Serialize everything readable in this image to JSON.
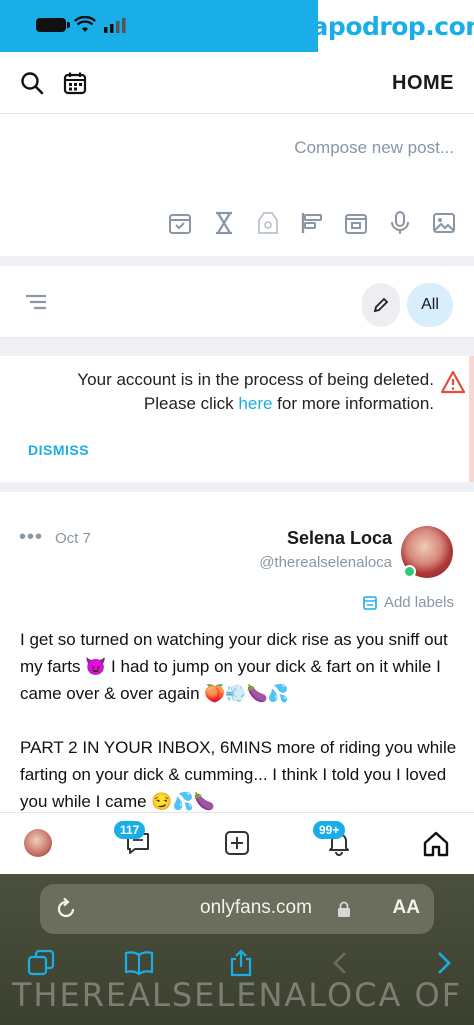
{
  "watermark": "fapodrop.com",
  "header": {
    "title": "HOME"
  },
  "composer": {
    "placeholder": "Compose new post..."
  },
  "filters": {
    "all_label": "All"
  },
  "alert": {
    "line1": "Your account is in the process of being deleted.",
    "line2_prefix": "Please click ",
    "link": "here",
    "line2_suffix": " for more information.",
    "dismiss": "DISMISS"
  },
  "post": {
    "author": "Selena Loca",
    "handle": "@therealselenaloca",
    "date": "Oct 7",
    "more": "•••",
    "add_labels": "Add labels",
    "paragraphs": [
      "I get so turned on watching your dick rise as you sniff out my farts 😈 I had to jump on your dick & fart on it while I came over & over again 🍑💨🍆💦",
      "PART 2 IN YOUR INBOX, 6MINS more of riding you while farting on your dick & cumming... I think I told you I loved you while I came 😏💦🍆"
    ]
  },
  "nav": {
    "messages_badge": "117",
    "notifications_badge": "99+"
  },
  "browser": {
    "url": "onlyfans.com",
    "aa": "AA"
  },
  "overlay": "THEREALSELENALOCA OF",
  "colors": {
    "accent": "#1aaee8",
    "online": "#2ecc71",
    "browser_bg": "#3c402f"
  }
}
